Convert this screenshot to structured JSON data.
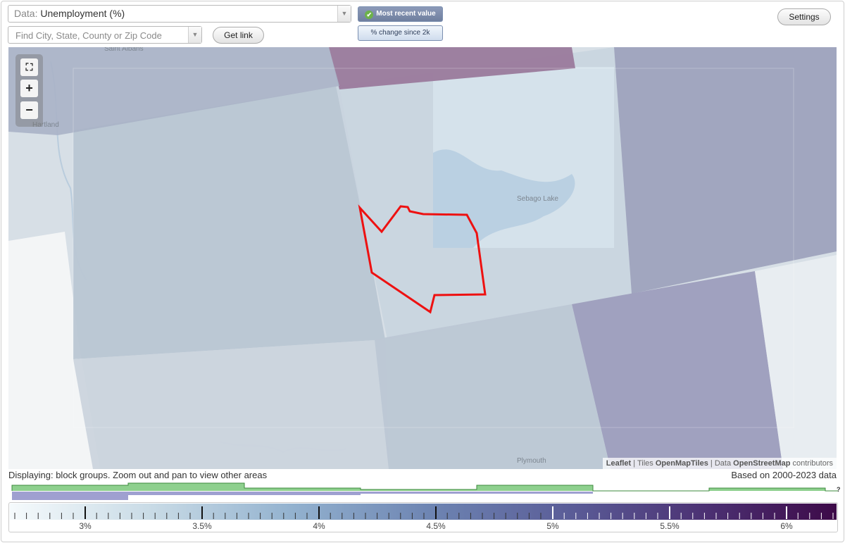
{
  "data_select": {
    "prefix": "Data:",
    "value": "Unemployment (%)"
  },
  "search": {
    "placeholder": "Find City, State, County or Zip Code"
  },
  "buttons": {
    "get_link": "Get link",
    "settings": "Settings"
  },
  "toggles": {
    "most_recent": "Most recent value",
    "pct_change": "% change since 2k"
  },
  "map": {
    "places": [
      "Saint Albans",
      "Hartland",
      "Sebago Lake",
      "Plymouth"
    ],
    "attribution": {
      "leaflet": "Leaflet",
      "tiles_prefix": "Tiles",
      "tiles": "OpenMapTiles",
      "data_prefix": "Data",
      "data": "OpenStreetMap",
      "suffix": "contributors"
    }
  },
  "footer": {
    "displaying": "Displaying: block groups. Zoom out and pan to view other areas",
    "based_on": "Based on 2000-2023 data",
    "histogram_unknown": "?"
  },
  "legend": {
    "labels": [
      "3%",
      "3.5%",
      "4%",
      "4.5%",
      "5%",
      "5.5%",
      "6%"
    ],
    "colors": [
      "#f5fafc",
      "#c9dbe6",
      "#93b2cf",
      "#6d84b2",
      "#5a5c97",
      "#4b2f71",
      "#3d0a48"
    ]
  },
  "colors": {
    "highlight": "#ee1111",
    "histogram_green": "#8ed08e",
    "histogram_purple": "#9fa0d0"
  }
}
